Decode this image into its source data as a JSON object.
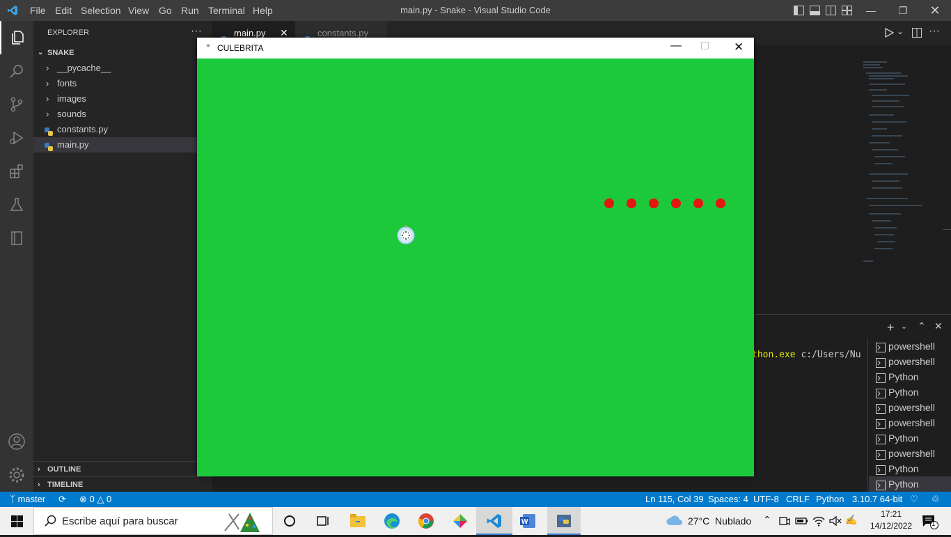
{
  "titlebar": {
    "menus": [
      "File",
      "Edit",
      "Selection",
      "View",
      "Go",
      "Run",
      "Terminal",
      "Help"
    ],
    "window_title": "main.py - Snake - Visual Studio Code"
  },
  "sidebar": {
    "header": "EXPLORER",
    "more": "···",
    "root": "SNAKE",
    "items": [
      {
        "label": "__pycache__",
        "type": "folder"
      },
      {
        "label": "fonts",
        "type": "folder"
      },
      {
        "label": "images",
        "type": "folder"
      },
      {
        "label": "sounds",
        "type": "folder"
      },
      {
        "label": "constants.py",
        "type": "file"
      },
      {
        "label": "main.py",
        "type": "file",
        "selected": true
      }
    ],
    "outline": "OUTLINE",
    "timeline": "TIMELINE"
  },
  "tabs": [
    {
      "label": "main.py",
      "active": true
    },
    {
      "label": "constants.py",
      "active": false
    }
  ],
  "terminal": {
    "visible_text_1": "thon.exe",
    "visible_text_2": " c:/Users/Nu",
    "instances": [
      "powershell",
      "powershell",
      "Python",
      "Python",
      "powershell",
      "powershell",
      "Python",
      "powershell",
      "Python",
      "Python"
    ]
  },
  "statusbar": {
    "branch": "master",
    "errors": "0",
    "warnings": "0",
    "position": "Ln 115, Col 39",
    "spaces": "Spaces: 4",
    "encoding": "UTF-8",
    "eol": "CRLF",
    "language": "Python",
    "interpreter": "3.10.7 64-bit"
  },
  "game_window": {
    "title": "CULEBRITA",
    "background": "#1bc93a",
    "snake_color": "#e2170f",
    "snake_segments": 6
  },
  "taskbar": {
    "search_placeholder": "Escribe aquí para buscar",
    "weather": "27°C  Nublado",
    "time": "17:21",
    "date": "14/12/2022",
    "notifications": "1"
  },
  "colors": {
    "accent": "#007acc",
    "titlebar": "#3c3c3c",
    "sidebar": "#252526",
    "activitybar": "#333333"
  }
}
